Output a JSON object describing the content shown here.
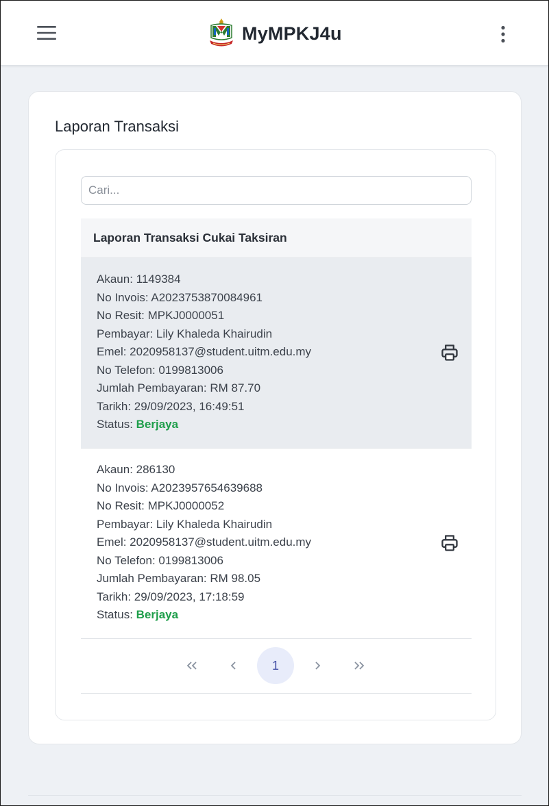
{
  "header": {
    "app_title": "MyMPKJ4u"
  },
  "page": {
    "title": "Laporan Transaksi"
  },
  "search": {
    "placeholder": "Cari..."
  },
  "table": {
    "header": "Laporan Transaksi Cukai Taksiran",
    "rows": [
      {
        "akaun": "Akaun: 1149384",
        "invois": "No Invois: A2023753870084961",
        "resit": "No Resit: MPKJ0000051",
        "pembayar": "Pembayar: Lily Khaleda Khairudin",
        "emel": "Emel: 2020958137@student.uitm.edu.my",
        "telefon": "No Telefon: 0199813006",
        "jumlah": "Jumlah Pembayaran: RM 87.70",
        "tarikh": "Tarikh: 29/09/2023, 16:49:51",
        "status_label": "Status: ",
        "status_value": "Berjaya"
      },
      {
        "akaun": "Akaun: 286130",
        "invois": "No Invois: A2023957654639688",
        "resit": "No Resit: MPKJ0000052",
        "pembayar": "Pembayar: Lily Khaleda Khairudin",
        "emel": "Emel: 2020958137@student.uitm.edu.my",
        "telefon": "No Telefon: 0199813006",
        "jumlah": "Jumlah Pembayaran: RM 98.05",
        "tarikh": "Tarikh: 29/09/2023, 17:18:59",
        "status_label": "Status: ",
        "status_value": "Berjaya"
      }
    ]
  },
  "pagination": {
    "first": "«",
    "prev": "‹",
    "current": "1",
    "next": "›",
    "last": "»"
  },
  "icons": {
    "menu": "hamburger-menu-icon",
    "more": "kebab-menu-icon",
    "print": "printer-icon"
  },
  "colors": {
    "status_success": "#1e9e4a",
    "active_page_bg": "#e8ecfa",
    "active_page_text": "#4450a6"
  }
}
